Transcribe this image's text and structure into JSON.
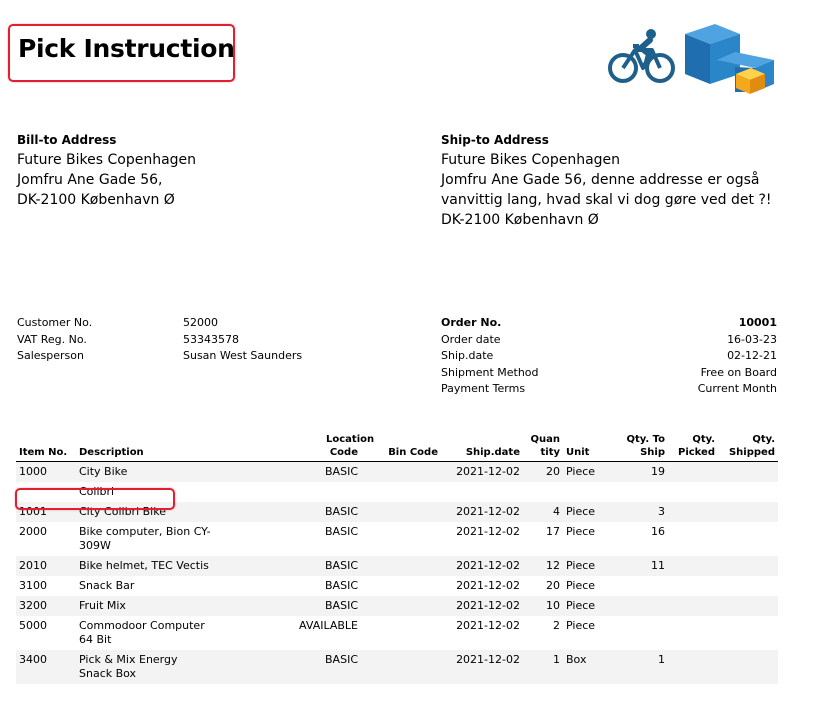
{
  "title": "Pick Instruction",
  "colors": {
    "highlight": "#e02030",
    "logo_blue": "#1f5f8b",
    "cube_blue": "#2a86c9",
    "cube_orange": "#f4a91c"
  },
  "logo": {
    "icons": [
      "bicycle-icon",
      "boxes-icon"
    ]
  },
  "bill_to": {
    "heading": "Bill-to Address",
    "lines": [
      "Future Bikes Copenhagen",
      "Jomfru Ane Gade 56,",
      "DK-2100 København Ø"
    ]
  },
  "ship_to": {
    "heading": "Ship-to Address",
    "lines": [
      "Future Bikes Copenhagen",
      "Jomfru Ane Gade 56, denne addresse er også",
      "vanvittig lang, hvad skal vi dog gøre ved det ?!",
      "DK-2100 København Ø"
    ]
  },
  "customer": {
    "customer_no_label": "Customer No.",
    "customer_no": "52000",
    "vat_label": "VAT Reg. No.",
    "vat": "53343578",
    "salesperson_label": "Salesperson",
    "salesperson": "Susan West Saunders"
  },
  "order": {
    "order_no_label": "Order No.",
    "order_no": "10001",
    "order_date_label": "Order date",
    "order_date": "16-03-23",
    "ship_date_label": "Ship.date",
    "ship_date": "02-12-21",
    "shipment_method_label": "Shipment Method",
    "shipment_method": "Free on Board",
    "payment_terms_label": "Payment Terms",
    "payment_terms": "Current Month"
  },
  "table": {
    "headers": {
      "item_no": "Item No.",
      "description": "Description",
      "location_code": "Location Code",
      "bin_code": "Bin Code",
      "ship_date": "Ship.date",
      "quantity": "Quantity",
      "unit": "Unit",
      "qty_to_ship": "Qty. To Ship",
      "qty_picked": "Qty. Picked",
      "qty_shipped": "Qty. Shipped"
    },
    "rows": [
      {
        "item_no": "1000",
        "description": "City Bike",
        "location_code": "BASIC",
        "bin_code": "",
        "ship_date": "2021-12-02",
        "quantity": "20",
        "unit": "Piece",
        "qty_to_ship": "19",
        "qty_picked": "",
        "qty_shipped": ""
      },
      {
        "item_no": "",
        "description": "Colibri",
        "location_code": "",
        "bin_code": "",
        "ship_date": "",
        "quantity": "",
        "unit": "",
        "qty_to_ship": "",
        "qty_picked": "",
        "qty_shipped": ""
      },
      {
        "item_no": "1001",
        "description": "City Colibri Bike",
        "location_code": "BASIC",
        "bin_code": "",
        "ship_date": "2021-12-02",
        "quantity": "4",
        "unit": "Piece",
        "qty_to_ship": "3",
        "qty_picked": "",
        "qty_shipped": ""
      },
      {
        "item_no": "2000",
        "description": "Bike computer, Bion CY-309W",
        "location_code": "BASIC",
        "bin_code": "",
        "ship_date": "2021-12-02",
        "quantity": "17",
        "unit": "Piece",
        "qty_to_ship": "16",
        "qty_picked": "",
        "qty_shipped": ""
      },
      {
        "item_no": "2010",
        "description": "Bike helmet, TEC Vectis",
        "location_code": "BASIC",
        "bin_code": "",
        "ship_date": "2021-12-02",
        "quantity": "12",
        "unit": "Piece",
        "qty_to_ship": "11",
        "qty_picked": "",
        "qty_shipped": ""
      },
      {
        "item_no": "3100",
        "description": "Snack Bar",
        "location_code": "BASIC",
        "bin_code": "",
        "ship_date": "2021-12-02",
        "quantity": "20",
        "unit": "Piece",
        "qty_to_ship": "",
        "qty_picked": "",
        "qty_shipped": ""
      },
      {
        "item_no": "3200",
        "description": "Fruit Mix",
        "location_code": "BASIC",
        "bin_code": "",
        "ship_date": "2021-12-02",
        "quantity": "10",
        "unit": "Piece",
        "qty_to_ship": "",
        "qty_picked": "",
        "qty_shipped": ""
      },
      {
        "item_no": "5000",
        "description": "Commodoor Computer 64 Bit",
        "location_code": "AVAILABLE",
        "bin_code": "",
        "ship_date": "2021-12-02",
        "quantity": "2",
        "unit": "Piece",
        "qty_to_ship": "",
        "qty_picked": "",
        "qty_shipped": ""
      },
      {
        "item_no": "3400",
        "description": "Pick & Mix Energy Snack Box",
        "location_code": "BASIC",
        "bin_code": "",
        "ship_date": "2021-12-02",
        "quantity": "1",
        "unit": "Box",
        "qty_to_ship": "1",
        "qty_picked": "",
        "qty_shipped": ""
      }
    ]
  }
}
